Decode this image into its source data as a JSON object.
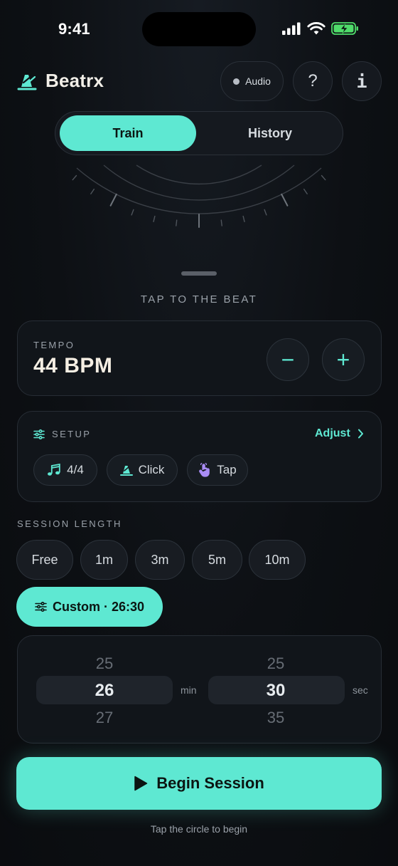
{
  "status_bar": {
    "time": "9:41"
  },
  "header": {
    "app_name": "Beatrx",
    "audio_label": "Audio",
    "help_label": "?",
    "info_label": "i"
  },
  "tabs": [
    {
      "label": "Train",
      "active": true
    },
    {
      "label": "History",
      "active": false
    }
  ],
  "tap_prompt": "TAP TO THE BEAT",
  "tempo": {
    "label": "TEMPO",
    "value": "44 BPM",
    "decrease_label": "−",
    "increase_label": "+"
  },
  "setup": {
    "label": "SETUP",
    "adjust_label": "Adjust",
    "chips": [
      {
        "label": "4/4",
        "icon": "music-notes-icon"
      },
      {
        "label": "Click",
        "icon": "metronome-icon"
      },
      {
        "label": "Tap",
        "icon": "hand-tap-icon"
      }
    ]
  },
  "session_length": {
    "label": "SESSION LENGTH",
    "options": [
      "Free",
      "1m",
      "3m",
      "5m",
      "10m"
    ],
    "custom_label": "Custom · 26:30"
  },
  "picker": {
    "minutes": {
      "above": "25",
      "selected": "26",
      "below": "27",
      "unit": "min"
    },
    "seconds": {
      "above": "25",
      "selected": "30",
      "below": "35",
      "unit": "sec"
    }
  },
  "begin_label": "Begin Session",
  "hint": "Tap the circle to begin",
  "colors": {
    "accent": "#5ee8d2",
    "background": "#0d1014",
    "card": "#11151a",
    "cream_text": "#f5eee3"
  }
}
